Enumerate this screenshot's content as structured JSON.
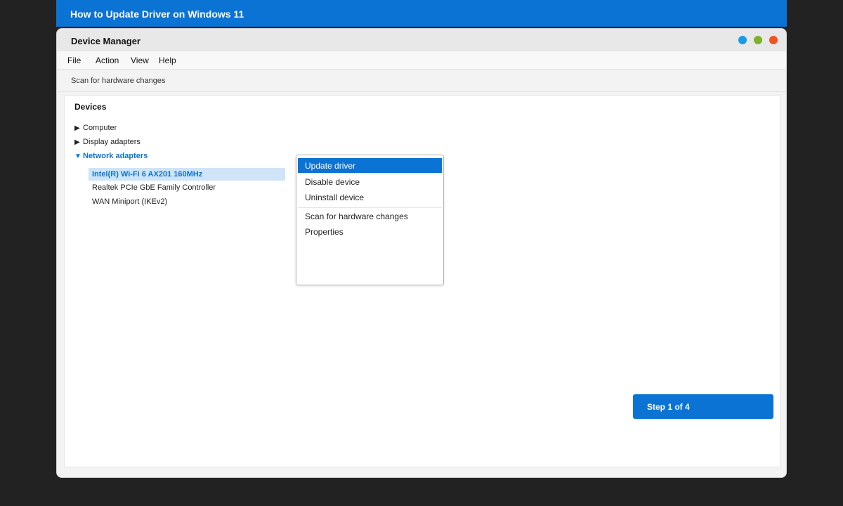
{
  "banner": {
    "title": "How to Update Driver on Windows 11"
  },
  "window": {
    "title": "Device Manager",
    "controls": [
      {
        "name": "minimize",
        "color": "#1a9ae8"
      },
      {
        "name": "maximize",
        "color": "#7bb325"
      },
      {
        "name": "close",
        "color": "#f25322"
      }
    ]
  },
  "menubar": {
    "items": [
      "File",
      "Action",
      "View",
      "Help"
    ]
  },
  "toolbar": {
    "scan_label": "Scan for hardware changes"
  },
  "devices": {
    "heading": "Devices",
    "categories": [
      {
        "label": "Computer",
        "expanded": false,
        "arrow": "▶"
      },
      {
        "label": "Display adapters",
        "expanded": false,
        "arrow": "▶"
      },
      {
        "label": "Network adapters",
        "expanded": true,
        "arrow": "▼"
      }
    ],
    "network_items": [
      "Intel(R) Wi-Fi 6 AX201 160MHz",
      "Realtek PCIe GbE Family Controller",
      "WAN Miniport (IKEv2)"
    ],
    "selected_index": 0
  },
  "context_menu": {
    "items": [
      "Update driver",
      "Disable device",
      "Uninstall device",
      "Scan for hardware changes",
      "Properties"
    ],
    "active_index": 0
  },
  "step": {
    "label": "Step 1 of 4"
  },
  "colors": {
    "accent": "#0a73d4",
    "selection_bg": "#cfe4f7",
    "desktop_bg": "#222222"
  }
}
